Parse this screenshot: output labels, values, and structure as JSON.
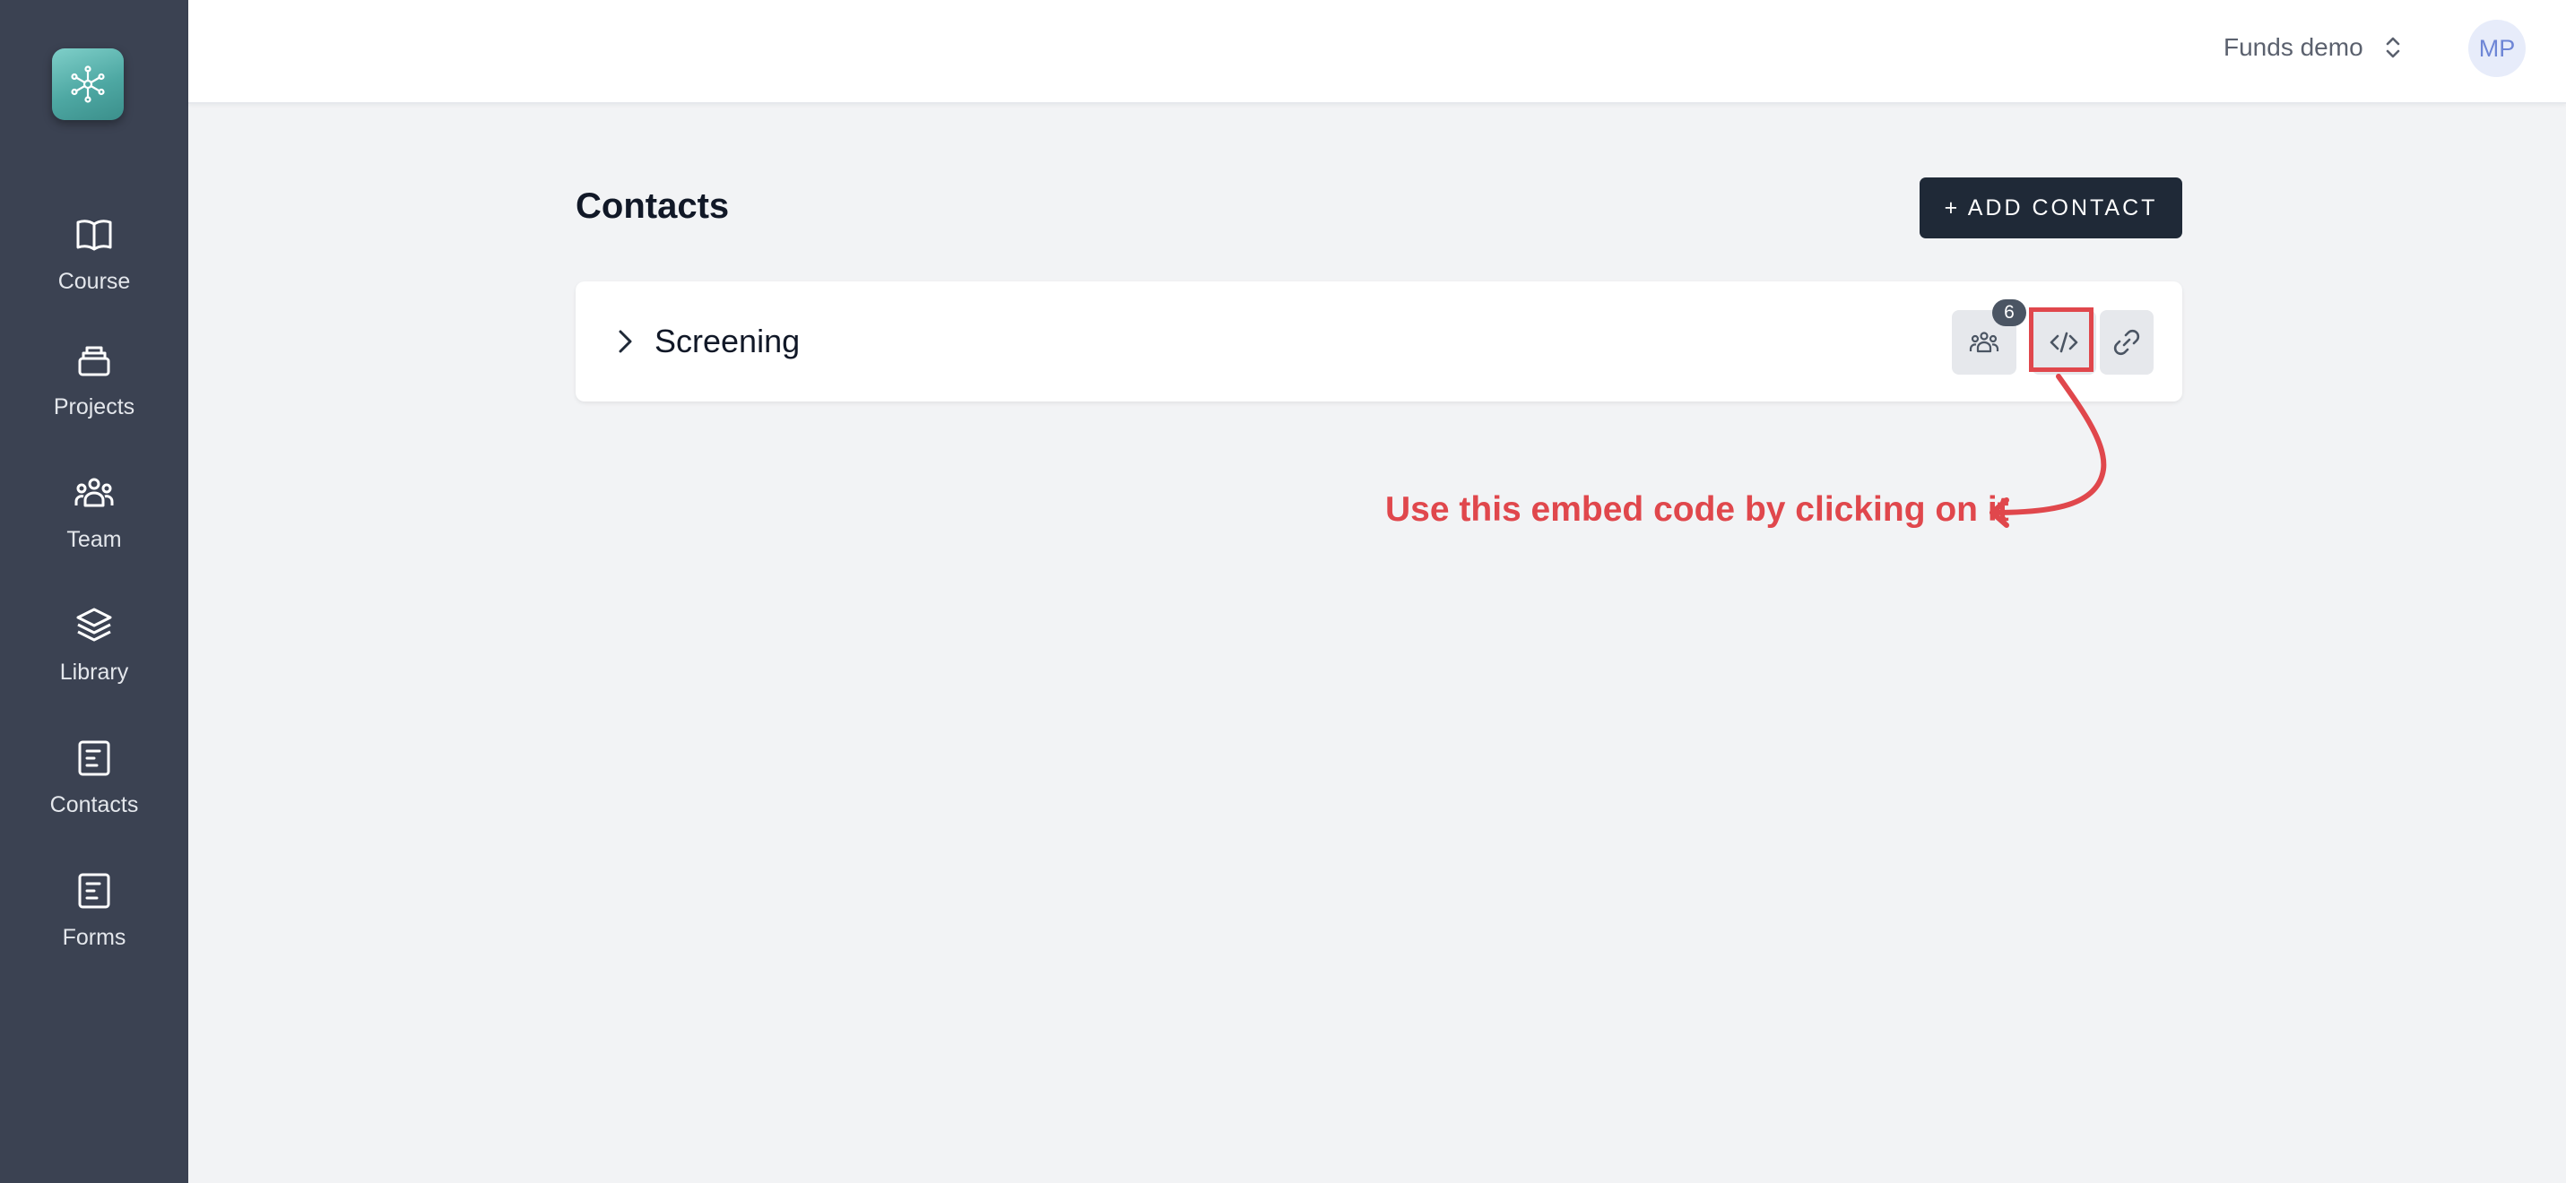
{
  "sidebar": {
    "logo_icon": "network-icon",
    "items": [
      {
        "label": "Course",
        "icon": "book-icon"
      },
      {
        "label": "Projects",
        "icon": "archive-icon"
      },
      {
        "label": "Team",
        "icon": "team-icon"
      },
      {
        "label": "Library",
        "icon": "layers-icon"
      },
      {
        "label": "Contacts",
        "icon": "document-icon"
      },
      {
        "label": "Forms",
        "icon": "document-icon"
      }
    ]
  },
  "header": {
    "workspace": "Funds demo",
    "avatar_initials": "MP"
  },
  "main": {
    "title": "Contacts",
    "add_button_label": "+ ADD CONTACT",
    "lists": [
      {
        "name": "Screening",
        "member_count": "6",
        "actions": [
          "members-icon",
          "code-icon",
          "link-icon"
        ]
      }
    ]
  },
  "annotation": {
    "text": "Use this embed code by clicking on it",
    "color": "#e0474c"
  },
  "colors": {
    "sidebar_bg": "#3b4252",
    "page_bg": "#f2f3f5",
    "primary_button": "#1f2937",
    "logo_teal": "#4ea8a3",
    "highlight": "#e0474c"
  }
}
